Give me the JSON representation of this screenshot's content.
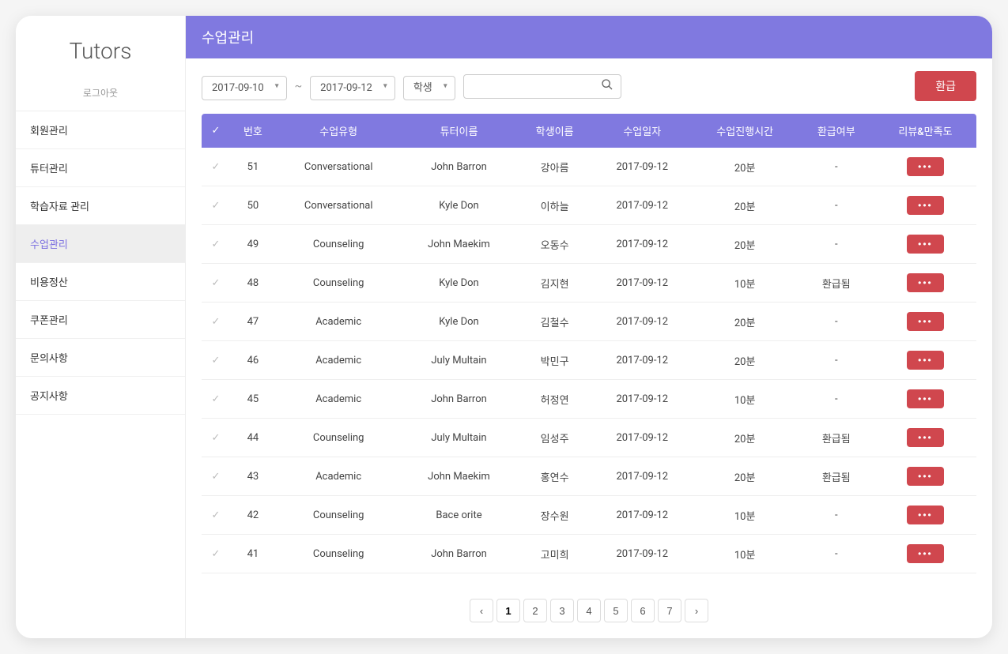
{
  "sidebar": {
    "logo": "Tutors",
    "logout": "로그아웃",
    "items": [
      {
        "label": "회원관리"
      },
      {
        "label": "튜터관리"
      },
      {
        "label": "학습자료 관리"
      },
      {
        "label": "수업관리"
      },
      {
        "label": "비용정산"
      },
      {
        "label": "쿠폰관리"
      },
      {
        "label": "문의사항"
      },
      {
        "label": "공지사항"
      }
    ],
    "activeIndex": 3
  },
  "header": {
    "title": "수업관리"
  },
  "toolbar": {
    "dateFrom": "2017-09-10",
    "dateTo": "2017-09-12",
    "filterLabel": "학생",
    "searchValue": "",
    "refundBtn": "환급"
  },
  "table": {
    "headers": [
      "",
      "번호",
      "수업유형",
      "튜터이름",
      "학생이름",
      "수업일자",
      "수업진행시간",
      "환급여부",
      "리뷰&만족도"
    ],
    "rows": [
      {
        "no": "51",
        "type": "Conversational",
        "tutor": "John Barron",
        "student": "강아름",
        "date": "2017-09-12",
        "duration": "20분",
        "refund": "-"
      },
      {
        "no": "50",
        "type": "Conversational",
        "tutor": "Kyle Don",
        "student": "이하늘",
        "date": "2017-09-12",
        "duration": "20분",
        "refund": "-"
      },
      {
        "no": "49",
        "type": "Counseling",
        "tutor": "John Maekim",
        "student": "오동수",
        "date": "2017-09-12",
        "duration": "20분",
        "refund": "-"
      },
      {
        "no": "48",
        "type": "Counseling",
        "tutor": "Kyle Don",
        "student": "김지현",
        "date": "2017-09-12",
        "duration": "10분",
        "refund": "환급됨"
      },
      {
        "no": "47",
        "type": "Academic",
        "tutor": "Kyle Don",
        "student": "김철수",
        "date": "2017-09-12",
        "duration": "20분",
        "refund": "-"
      },
      {
        "no": "46",
        "type": "Academic",
        "tutor": "July Multain",
        "student": "박민구",
        "date": "2017-09-12",
        "duration": "20분",
        "refund": "-"
      },
      {
        "no": "45",
        "type": "Academic",
        "tutor": "John Barron",
        "student": "허정연",
        "date": "2017-09-12",
        "duration": "10분",
        "refund": "-"
      },
      {
        "no": "44",
        "type": "Counseling",
        "tutor": "July Multain",
        "student": "임성주",
        "date": "2017-09-12",
        "duration": "20분",
        "refund": "환급됨"
      },
      {
        "no": "43",
        "type": "Academic",
        "tutor": "John Maekim",
        "student": "홍연수",
        "date": "2017-09-12",
        "duration": "20분",
        "refund": "환급됨"
      },
      {
        "no": "42",
        "type": "Counseling",
        "tutor": "Bace orite",
        "student": "장수원",
        "date": "2017-09-12",
        "duration": "10분",
        "refund": "-"
      },
      {
        "no": "41",
        "type": "Counseling",
        "tutor": "John Barron",
        "student": "고미희",
        "date": "2017-09-12",
        "duration": "10분",
        "refund": "-"
      }
    ],
    "moreLabel": "•••"
  },
  "pagination": {
    "pages": [
      "1",
      "2",
      "3",
      "4",
      "5",
      "6",
      "7"
    ],
    "activeIndex": 0
  }
}
